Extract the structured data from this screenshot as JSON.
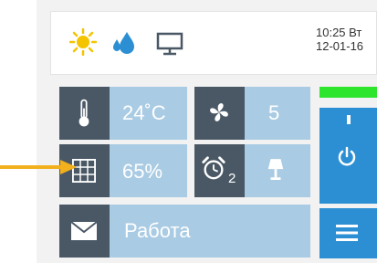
{
  "status": {
    "time": "10:25 Вт",
    "date": "12-01-16"
  },
  "tiles": {
    "temperature": "24˚C",
    "fan_speed": "5",
    "humidity": "65%",
    "alarm_count": "2",
    "mode_label": "Работа"
  },
  "colors": {
    "dark_tile": "#4a5866",
    "light_tile": "#a9cbe3",
    "accent_blue": "#2d8fd3",
    "green_indicator": "#2de52d",
    "arrow": "#f2b01c"
  },
  "icons": [
    "sun-icon",
    "water-drop-icon",
    "monitor-icon",
    "thermometer-icon",
    "fan-icon",
    "grid-icon",
    "alarm-clock-icon",
    "lamp-icon",
    "mail-icon",
    "power-icon",
    "menu-icon"
  ]
}
